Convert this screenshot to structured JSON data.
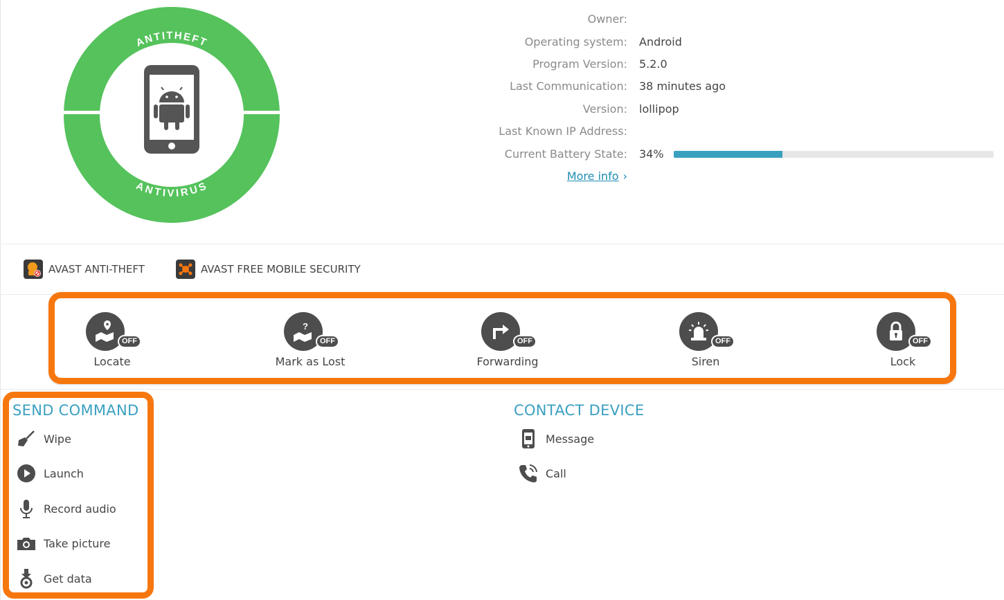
{
  "badge": {
    "top_text": "ANTITHEFT",
    "bottom_text": "ANTIVIRUS",
    "ring_color": "#55c25c",
    "phone_color": "#555555",
    "icon": "android-phone-icon"
  },
  "device_info": {
    "owner": {
      "label": "Owner:",
      "value": ""
    },
    "os": {
      "label": "Operating system:",
      "value": "Android"
    },
    "program_version": {
      "label": "Program Version:",
      "value": "5.2.0"
    },
    "last_communication": {
      "label": "Last Communication:",
      "value": "38 minutes ago"
    },
    "version": {
      "label": "Version:",
      "value": "lollipop"
    },
    "ip": {
      "label": "Last Known IP Address:",
      "value": ""
    },
    "battery": {
      "label": "Current Battery State:",
      "value": "34%",
      "level": 0.34,
      "color": "#3aa0c0"
    },
    "more_info": "More info"
  },
  "products": [
    {
      "label": "AVAST ANTI-THEFT",
      "icon": "avast-antitheft-logo-icon"
    },
    {
      "label": "AVAST FREE MOBILE SECURITY",
      "icon": "avast-mobile-security-logo-icon"
    }
  ],
  "features": [
    {
      "label": "Locate",
      "status": "OFF",
      "icon": "map-pin-icon"
    },
    {
      "label": "Mark as Lost",
      "status": "OFF",
      "icon": "map-question-icon"
    },
    {
      "label": "Forwarding",
      "status": "OFF",
      "icon": "forward-arrow-icon"
    },
    {
      "label": "Siren",
      "status": "OFF",
      "icon": "siren-icon"
    },
    {
      "label": "Lock",
      "status": "OFF",
      "icon": "padlock-icon"
    }
  ],
  "send_command": {
    "title": "SEND COMMAND",
    "items": [
      {
        "label": "Wipe",
        "icon": "broom-icon"
      },
      {
        "label": "Launch",
        "icon": "play-icon"
      },
      {
        "label": "Record audio",
        "icon": "microphone-icon"
      },
      {
        "label": "Take picture",
        "icon": "camera-icon"
      },
      {
        "label": "Get data",
        "icon": "download-data-icon"
      }
    ]
  },
  "contact_device": {
    "title": "CONTACT DEVICE",
    "items": [
      {
        "label": "Message",
        "icon": "phone-message-icon"
      },
      {
        "label": "Call",
        "icon": "phone-call-icon"
      }
    ]
  },
  "highlight_color": "#f7770f"
}
